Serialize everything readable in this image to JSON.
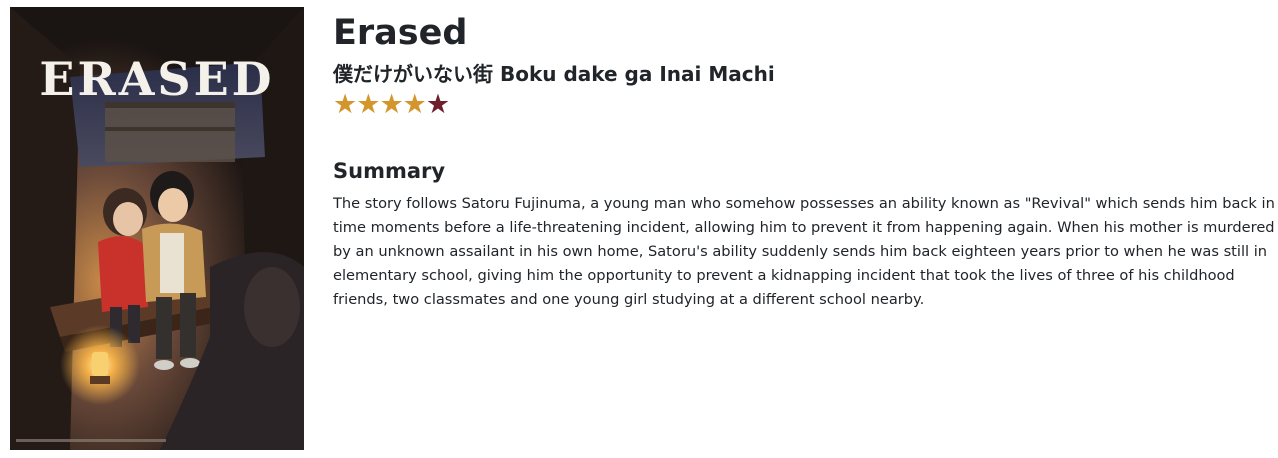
{
  "show": {
    "title": "Erased",
    "subtitle": "僕だけがいない街 Boku dake ga Inai Machi",
    "poster": {
      "logo_text": "ERASED",
      "alt": "Erased"
    },
    "rating": {
      "value": 4,
      "max": 5,
      "filled_color": "#d4952c",
      "empty_color": "#6e1f2e"
    }
  },
  "summary": {
    "heading": "Summary",
    "text": "The story follows Satoru Fujinuma, a young man who somehow possesses an ability known as \"Revival\" which sends him back in time moments before a life-threatening incident, allowing him to prevent it from happening again. When his mother is murdered by an unknown assailant in his own home, Satoru's ability suddenly sends him back eighteen years prior to when he was still in elementary school, giving him the opportunity to prevent a kidnapping incident that took the lives of three of his childhood friends, two classmates and one young girl studying at a different school nearby."
  }
}
